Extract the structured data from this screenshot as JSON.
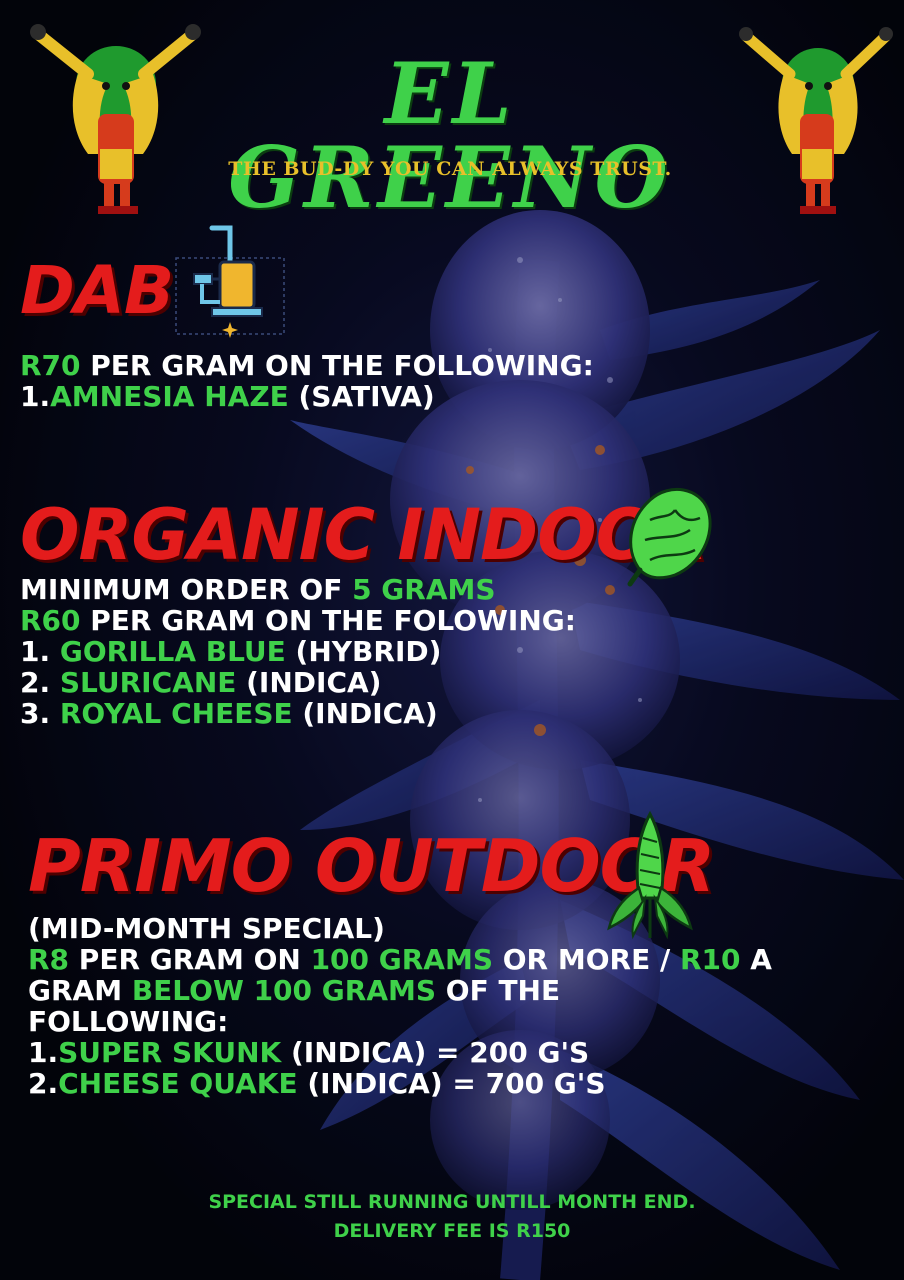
{
  "header": {
    "brand": "EL GREENO",
    "tagline": "THE BUD-DY YOU CAN ALWAYS TRUST."
  },
  "sections": {
    "dab": {
      "heading": "DAB",
      "icon": "dab-rig-icon",
      "lines": [
        [
          {
            "t": "R70",
            "c": "green"
          },
          {
            "t": " PER GRAM ON THE FOLLOWING:",
            "c": "white"
          }
        ],
        [
          {
            "t": "1.",
            "c": "white"
          },
          {
            "t": "AMNESIA HAZE",
            "c": "green"
          },
          {
            "t": " (SATIVA)",
            "c": "white"
          }
        ]
      ]
    },
    "organic_indoor": {
      "heading": "ORGANIC INDOOR",
      "icon": "cannabis-bud-icon",
      "lines": [
        [
          {
            "t": "MINIMUM ORDER OF ",
            "c": "white"
          },
          {
            "t": "5 GRAMS",
            "c": "green"
          }
        ],
        [
          {
            "t": "R60",
            "c": "green"
          },
          {
            "t": " PER GRAM ON THE FOLOWING:",
            "c": "white"
          }
        ],
        [
          {
            "t": "1. ",
            "c": "white"
          },
          {
            "t": "GORILLA BLUE",
            "c": "green"
          },
          {
            "t": " (HYBRID)",
            "c": "white"
          }
        ],
        [
          {
            "t": "2. ",
            "c": "white"
          },
          {
            "t": "SLURICANE",
            "c": "green"
          },
          {
            "t": " (INDICA)",
            "c": "white"
          }
        ],
        [
          {
            "t": "3. ",
            "c": "white"
          },
          {
            "t": "ROYAL CHEESE",
            "c": "green"
          },
          {
            "t": " (INDICA)",
            "c": "white"
          }
        ]
      ]
    },
    "primo_outdoor": {
      "heading": "PRIMO OUTDOOR",
      "icon": "cannabis-plant-icon",
      "lines": [
        [
          {
            "t": "(MID-MONTH SPECIAL)",
            "c": "white"
          }
        ],
        [
          {
            "t": "R8",
            "c": "green"
          },
          {
            "t": " PER GRAM ON ",
            "c": "white"
          },
          {
            "t": "100 GRAMS",
            "c": "green"
          },
          {
            "t": " OR MORE / ",
            "c": "white"
          },
          {
            "t": "R10",
            "c": "green"
          },
          {
            "t": " A",
            "c": "white"
          }
        ],
        [
          {
            "t": "GRAM ",
            "c": "white"
          },
          {
            "t": "BELOW 100 GRAMS",
            "c": "green"
          },
          {
            "t": " OF THE",
            "c": "white"
          }
        ],
        [
          {
            "t": "FOLLOWING:",
            "c": "white"
          }
        ],
        [
          {
            "t": "1.",
            "c": "white"
          },
          {
            "t": "SUPER SKUNK",
            "c": "green"
          },
          {
            "t": " (INDICA) = 200 G'S",
            "c": "white"
          }
        ],
        [
          {
            "t": "2.",
            "c": "white"
          },
          {
            "t": "CHEESE QUAKE",
            "c": "green"
          },
          {
            "t": " (INDICA) = 700 G'S",
            "c": "white"
          }
        ]
      ]
    }
  },
  "footer": {
    "line1": "SPECIAL STILL RUNNING UNTILL MONTH END.",
    "line2": "DELIVERY FEE IS R150"
  },
  "colors": {
    "accent_green": "#3fd14a",
    "heading_red": "#e41c1c",
    "tagline_gold": "#e8c02a",
    "background": "#02040a"
  },
  "icons": [
    "rasta-mascot-icon",
    "dab-rig-icon",
    "cannabis-bud-icon",
    "cannabis-plant-icon"
  ]
}
